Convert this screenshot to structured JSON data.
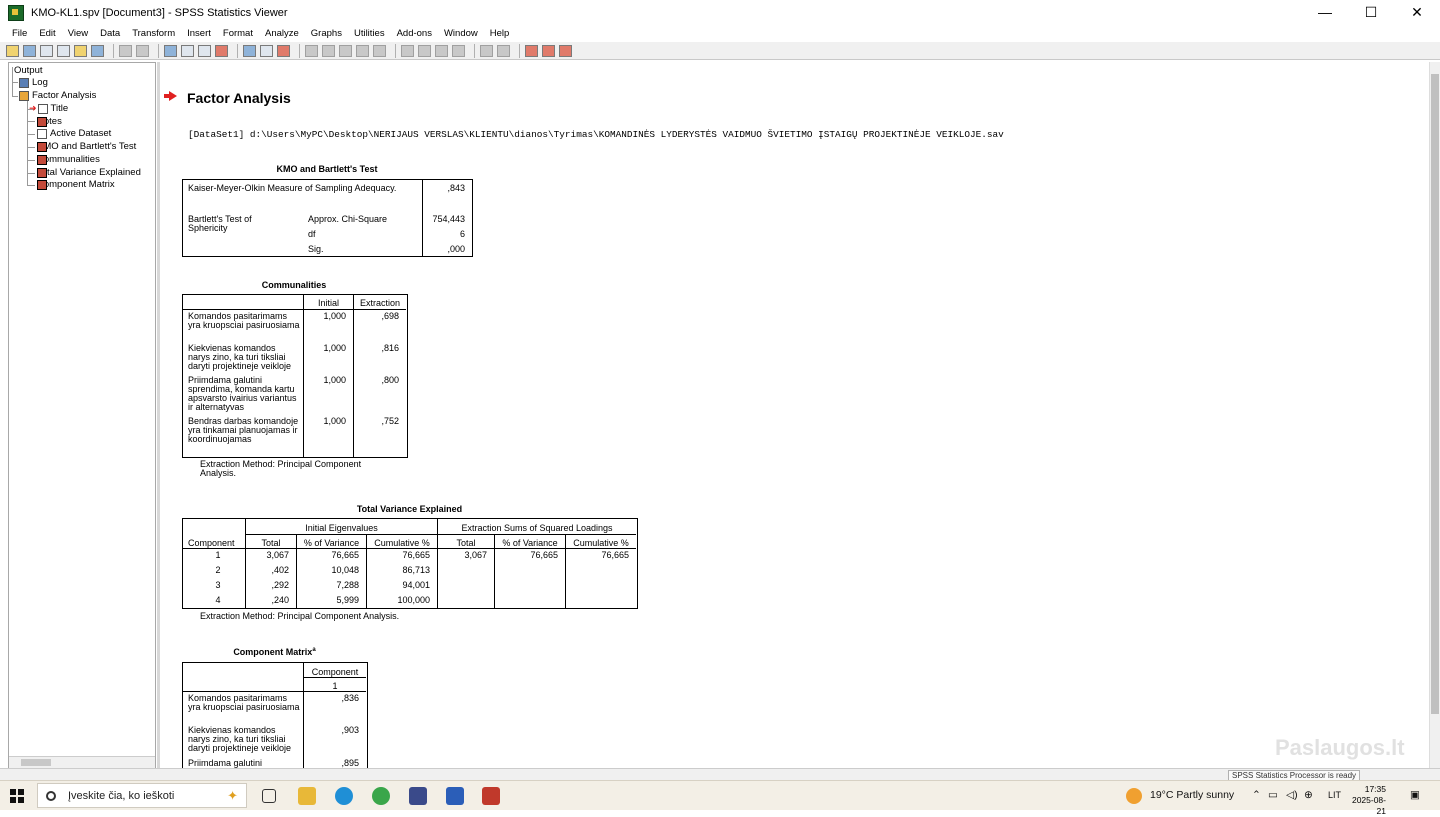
{
  "window": {
    "title": "KMO-KL1.spv [Document3] - SPSS Statistics Viewer",
    "minimize": "—",
    "maximize": "☐",
    "close": "✕"
  },
  "menu": [
    "File",
    "Edit",
    "View",
    "Data",
    "Transform",
    "Insert",
    "Format",
    "Analyze",
    "Graphs",
    "Utilities",
    "Add-ons",
    "Window",
    "Help"
  ],
  "tree": {
    "output": "Output",
    "log": "Log",
    "factor_analysis": "Factor Analysis",
    "title": "Title",
    "notes": "Notes",
    "active_dataset": "Active Dataset",
    "kmo": "KMO and Bartlett's Test",
    "communalities": "Communalities",
    "total_variance": "Total Variance Explained",
    "component_matrix": "Component Matrix"
  },
  "output": {
    "heading": "Factor Analysis",
    "dataset_line": "[DataSet1] d:\\Users\\MyPC\\Desktop\\NERIJAUS VERSLAS\\KLIENTU\\dianos\\Tyrimas\\KOMANDINĖS LYDERYSTĖS VAIDMUO ŠVIETIMO ĮSTAIGŲ  PROJEKTINĖJE VEIKLOJE.sav",
    "kmo": {
      "caption": "KMO and Bartlett's Test",
      "kmo_label": "Kaiser-Meyer-Olkin Measure of Sampling Adequacy.",
      "kmo_value": ",843",
      "bartlett_label": "Bartlett's Test of Sphericity",
      "chi_label": "Approx. Chi-Square",
      "chi_value": "754,443",
      "df_label": "df",
      "df_value": "6",
      "sig_label": "Sig.",
      "sig_value": ",000"
    },
    "communalities": {
      "caption": "Communalities",
      "col_initial": "Initial",
      "col_extraction": "Extraction",
      "rows": [
        {
          "label": "Komandos pasitarimams yra kruopsciai pasiruosiama",
          "initial": "1,000",
          "extraction": ",698"
        },
        {
          "label": "Kiekvienas komandos narys zino, ka turi tiksliai daryti projektineje veikloje",
          "initial": "1,000",
          "extraction": ",816"
        },
        {
          "label": "Priimdama galutini sprendima, komanda kartu apsvarsto ivairius variantus ir alternatyvas",
          "initial": "1,000",
          "extraction": ",800"
        },
        {
          "label": "Bendras darbas komandoje yra tinkamai planuojamas ir koordinuojamas",
          "initial": "1,000",
          "extraction": ",752"
        }
      ],
      "note": "Extraction Method: Principal Component Analysis."
    },
    "tve": {
      "caption": "Total Variance Explained",
      "component": "Component",
      "initial_eigen": "Initial Eigenvalues",
      "extraction_sums": "Extraction Sums of Squared Loadings",
      "total": "Total",
      "pct_var": "% of Variance",
      "cum_pct": "Cumulative %",
      "rows": [
        {
          "c": "1",
          "t": "3,067",
          "v": "76,665",
          "cu": "76,665",
          "et": "3,067",
          "ev": "76,665",
          "ecu": "76,665"
        },
        {
          "c": "2",
          "t": ",402",
          "v": "10,048",
          "cu": "86,713",
          "et": "",
          "ev": "",
          "ecu": ""
        },
        {
          "c": "3",
          "t": ",292",
          "v": "7,288",
          "cu": "94,001",
          "et": "",
          "ev": "",
          "ecu": ""
        },
        {
          "c": "4",
          "t": ",240",
          "v": "5,999",
          "cu": "100,000",
          "et": "",
          "ev": "",
          "ecu": ""
        }
      ],
      "note": "Extraction Method: Principal Component Analysis."
    },
    "cm": {
      "caption": "Component Matrix",
      "sup": "a",
      "component": "Component",
      "one": "1",
      "rows": [
        {
          "label": "Komandos pasitarimams yra kruopsciai pasiruosiama",
          "value": ",836"
        },
        {
          "label": "Kiekvienas komandos narys zino, ka turi tiksliai daryti projektineje veikloje",
          "value": ",903"
        },
        {
          "label": "Priimdama galutini",
          "value": ",895"
        }
      ]
    }
  },
  "statusbar": "SPSS Statistics Processor is ready",
  "taskbar": {
    "search_placeholder": "Įveskite čia, ko ieškoti",
    "weather": "19°C  Partly sunny",
    "lang": "LIT",
    "time": "17:35",
    "date": "2025-08-21"
  },
  "watermark": "Paslaugos.lt"
}
